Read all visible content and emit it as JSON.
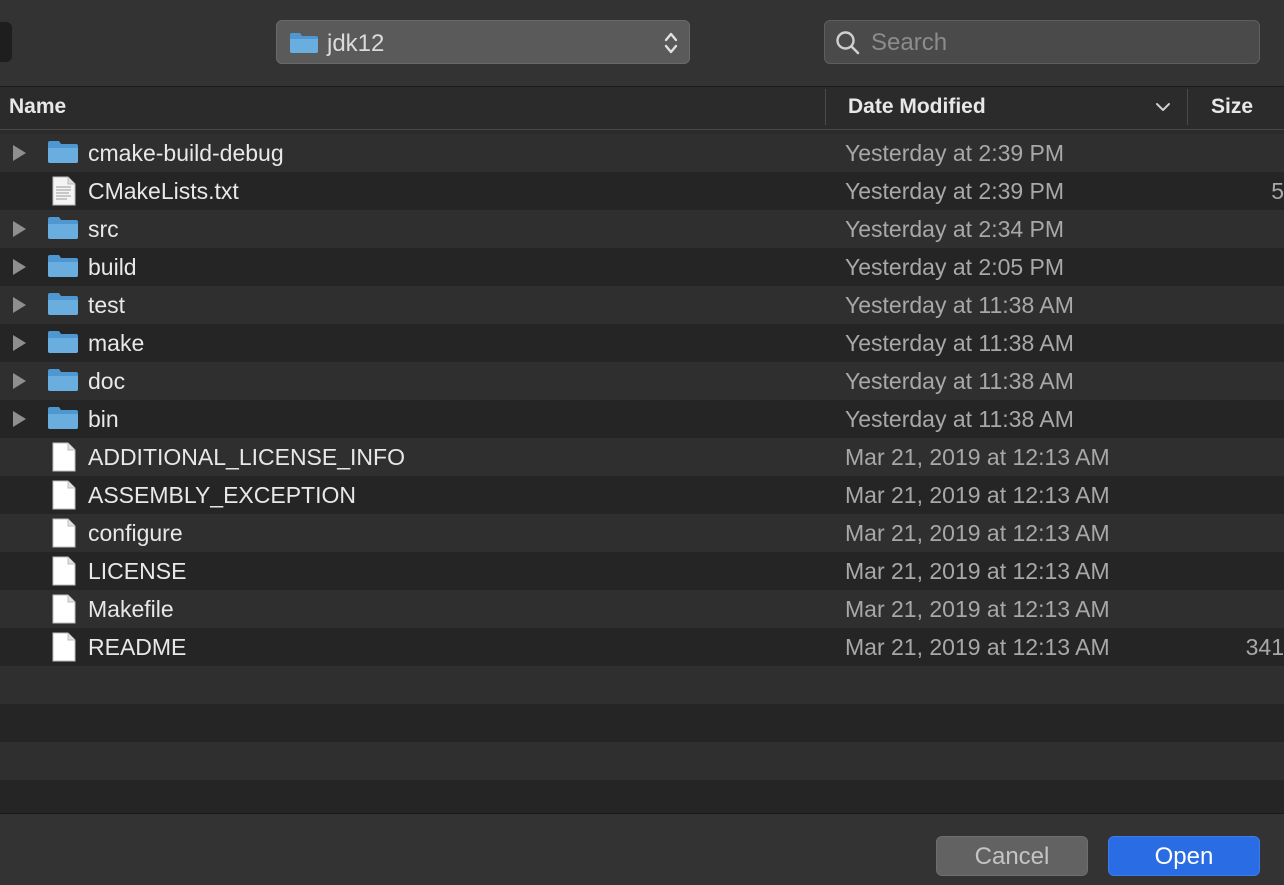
{
  "toolbar": {
    "location": "jdk12",
    "search_placeholder": "Search"
  },
  "columns": {
    "name": "Name",
    "date_modified": "Date Modified",
    "size": "Size"
  },
  "files": [
    {
      "name": "cmake-build-debug",
      "kind": "folder",
      "date": "Yesterday at 2:39 PM",
      "size": ""
    },
    {
      "name": "CMakeLists.txt",
      "kind": "text",
      "date": "Yesterday at 2:39 PM",
      "size": "5"
    },
    {
      "name": "src",
      "kind": "folder",
      "date": "Yesterday at 2:34 PM",
      "size": ""
    },
    {
      "name": "build",
      "kind": "folder",
      "date": "Yesterday at 2:05 PM",
      "size": ""
    },
    {
      "name": "test",
      "kind": "folder",
      "date": "Yesterday at 11:38 AM",
      "size": ""
    },
    {
      "name": "make",
      "kind": "folder",
      "date": "Yesterday at 11:38 AM",
      "size": ""
    },
    {
      "name": "doc",
      "kind": "folder",
      "date": "Yesterday at 11:38 AM",
      "size": ""
    },
    {
      "name": "bin",
      "kind": "folder",
      "date": "Yesterday at 11:38 AM",
      "size": ""
    },
    {
      "name": "ADDITIONAL_LICENSE_INFO",
      "kind": "file",
      "date": "Mar 21, 2019 at 12:13 AM",
      "size": ""
    },
    {
      "name": "ASSEMBLY_EXCEPTION",
      "kind": "file",
      "date": "Mar 21, 2019 at 12:13 AM",
      "size": ""
    },
    {
      "name": "configure",
      "kind": "file",
      "date": "Mar 21, 2019 at 12:13 AM",
      "size": ""
    },
    {
      "name": "LICENSE",
      "kind": "file",
      "date": "Mar 21, 2019 at 12:13 AM",
      "size": ""
    },
    {
      "name": "Makefile",
      "kind": "file",
      "date": "Mar 21, 2019 at 12:13 AM",
      "size": ""
    },
    {
      "name": "README",
      "kind": "file",
      "date": "Mar 21, 2019 at 12:13 AM",
      "size": "341"
    }
  ],
  "buttons": {
    "cancel": "Cancel",
    "open": "Open"
  },
  "colors": {
    "folder": "#6aaee0",
    "accent": "#2a6ce3"
  }
}
